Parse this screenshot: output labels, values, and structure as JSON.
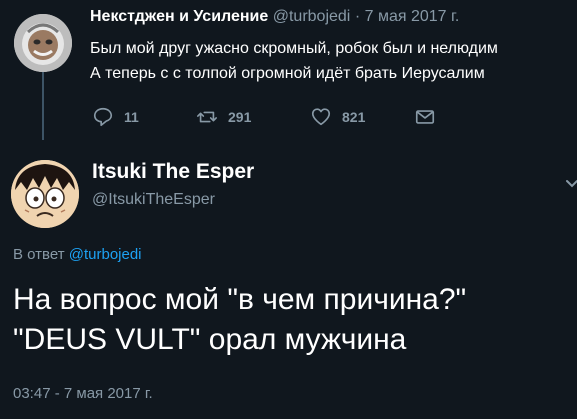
{
  "tweet1": {
    "name": "Некстджен и Усиление",
    "handle": "@turbojedi",
    "separator": "·",
    "date": "7 мая 2017 г.",
    "lines": [
      "Был мой друг ужасно скромный, робок был и нелюдим",
      "А теперь с с толпой огромной идёт брать Иерусалим"
    ],
    "actions": {
      "reply_count": "11",
      "retweet_count": "291",
      "like_count": "821"
    }
  },
  "tweet2": {
    "name": "Itsuki The Esper",
    "handle": "@ItsukiTheEsper",
    "reply_prefix": "В ответ",
    "reply_mention": "@turbojedi",
    "lines": [
      "На вопрос мой \"в чем причина?\"",
      "\"DEUS VULT\" орал мужчина"
    ],
    "timestamp": "03:47 - 7 мая 2017 г."
  },
  "colors": {
    "background": "#10171e",
    "muted": "#8899a6",
    "accent": "#1da1f2",
    "thread_line": "#3d5466"
  },
  "icons": [
    "reply-icon",
    "retweet-icon",
    "like-icon",
    "dm-icon",
    "chevron-down-icon"
  ]
}
